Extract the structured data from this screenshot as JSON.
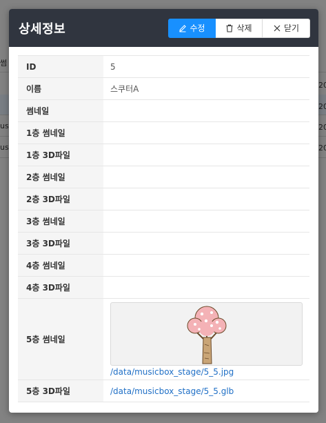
{
  "modal": {
    "title": "상세정보",
    "buttons": {
      "edit": "수정",
      "delete": "삭제",
      "close": "닫기"
    }
  },
  "details": [
    {
      "label": "ID",
      "value": "5"
    },
    {
      "label": "이름",
      "value": "스쿠터A"
    },
    {
      "label": "썸네일",
      "value": ""
    },
    {
      "label": "1층 썸네일",
      "value": ""
    },
    {
      "label": "1층 3D파일",
      "value": ""
    },
    {
      "label": "2층 썸네일",
      "value": ""
    },
    {
      "label": "2층 3D파일",
      "value": ""
    },
    {
      "label": "3층 썸네일",
      "value": ""
    },
    {
      "label": "3층 3D파일",
      "value": ""
    },
    {
      "label": "4층 썸네일",
      "value": ""
    },
    {
      "label": "4층 3D파일",
      "value": ""
    },
    {
      "label": "5층 썸네일",
      "value": "/data/musicbox_stage/5_5.jpg"
    },
    {
      "label": "5층 3D파일",
      "value": "/data/musicbox_stage/5_5.glb"
    }
  ],
  "background": {
    "fragments": [
      "썸",
      "us",
      "us",
      "20",
      "20",
      "20",
      "20"
    ]
  },
  "icons": {
    "edit": "pencil-icon",
    "delete": "trash-icon",
    "close": "close-icon"
  },
  "colors": {
    "header": "#30353f",
    "primary": "#1890ff",
    "link": "#1f6fc6"
  }
}
